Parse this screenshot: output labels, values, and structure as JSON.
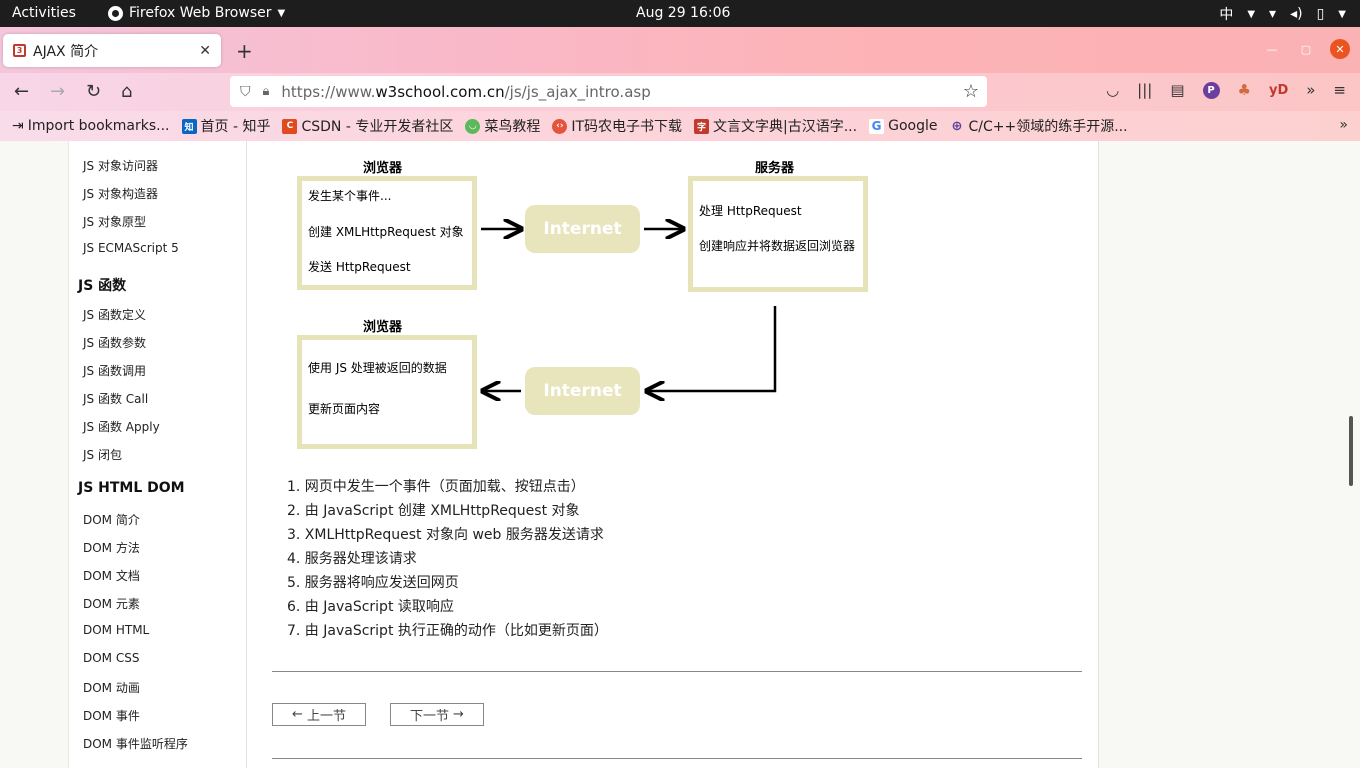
{
  "system": {
    "activities": "Activities",
    "app_name": "Firefox Web Browser",
    "clock": "Aug 29  16:06",
    "input_method": "中"
  },
  "browser": {
    "tab_title": "AJAX 简介",
    "url_host_prefix": "https://www.",
    "url_host": "w3school.com.cn",
    "url_path": "/js/js_ajax_intro.asp",
    "bookmarks": [
      {
        "label": "Import bookmarks...",
        "icon": "import-icon",
        "color": "#555555"
      },
      {
        "label": "首页 - 知乎",
        "icon": "zhihu-icon",
        "color": "#0a66c2"
      },
      {
        "label": "CSDN - 专业开发者社区",
        "icon": "csdn-icon",
        "color": "#e04a1e"
      },
      {
        "label": "菜鸟教程",
        "icon": "runoob-icon",
        "color": "#5cb85c"
      },
      {
        "label": "IT码农电子书下载",
        "icon": "itbook-icon",
        "color": "#e5533c"
      },
      {
        "label": "文言文字典|古汉语字...",
        "icon": "dict-icon",
        "color": "#c0392b"
      },
      {
        "label": "Google",
        "icon": "google-icon",
        "color": "#4285f4"
      },
      {
        "label": "C/C++领域的练手开源...",
        "icon": "globe-icon",
        "color": "#5b3fa0"
      }
    ]
  },
  "sidebar": {
    "items_top": [
      "JS 对象访问器",
      "JS 对象构造器",
      "JS 对象原型",
      "JS ECMAScript 5"
    ],
    "heading_functions": "JS 函数",
    "items_functions": [
      "JS 函数定义",
      "JS 函数参数",
      "JS 函数调用",
      "JS 函数 Call",
      "JS 函数 Apply",
      "JS 闭包"
    ],
    "heading_dom": "JS HTML DOM",
    "items_dom": [
      "DOM 简介",
      "DOM 方法",
      "DOM 文档",
      "DOM 元素",
      "DOM HTML",
      "DOM CSS",
      "DOM 动画",
      "DOM 事件",
      "DOM 事件监听程序"
    ]
  },
  "diagram": {
    "browser_label": "浏览器",
    "server_label": "服务器",
    "browser_lines": [
      "发生某个事件...",
      "创建 XMLHttpRequest 对象",
      "发送 HttpRequest"
    ],
    "server_lines": [
      "处理 HttpRequest",
      "创建响应并将数据返回浏览器"
    ],
    "browser2_lines": [
      "使用 JS 处理被返回的数据",
      "更新页面内容"
    ],
    "internet": "Internet"
  },
  "steps": [
    "1. 网页中发生一个事件（页面加载、按钮点击）",
    "2. 由 JavaScript 创建 XMLHttpRequest 对象",
    "3. XMLHttpRequest 对象向 web 服务器发送请求",
    "4. 服务器处理该请求",
    "5. 服务器将响应发送回网页",
    "6. 由 JavaScript 读取响应",
    "7. 由 JavaScript 执行正确的动作（比如更新页面）"
  ],
  "pager": {
    "prev": "上一节",
    "next": "下一节"
  }
}
